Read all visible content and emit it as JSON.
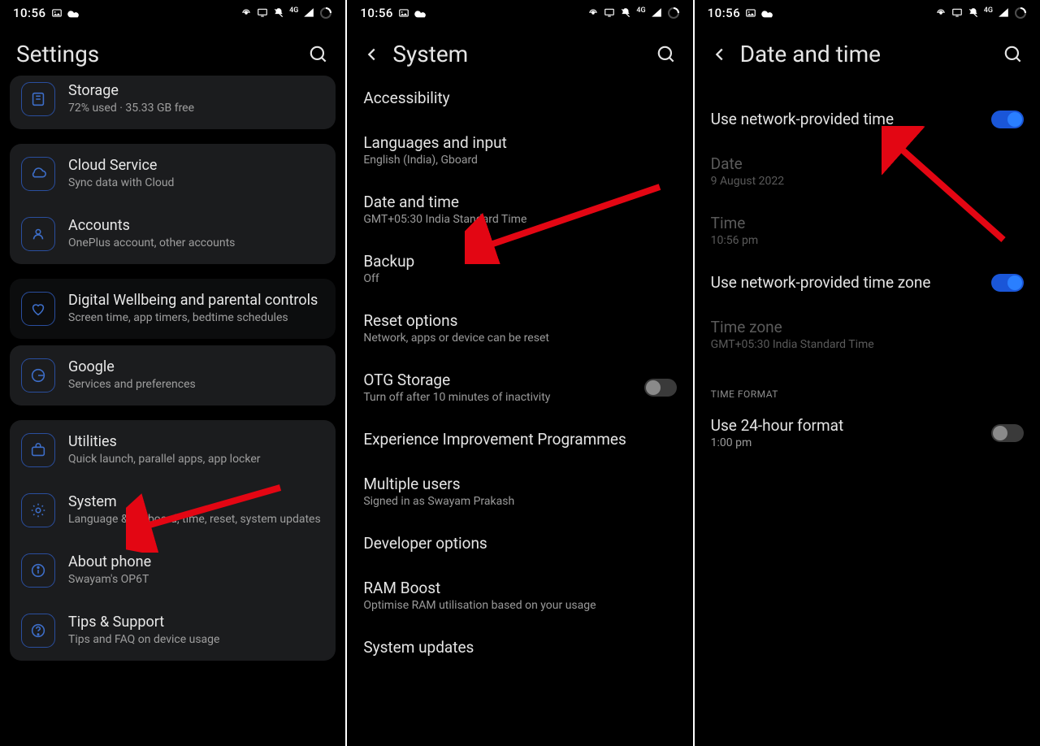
{
  "status": {
    "time": "10:56",
    "net_tag": "4G"
  },
  "p1": {
    "title": "Settings",
    "storage": {
      "title": "Storage",
      "sub": "72% used · 35.33 GB free"
    },
    "cloud": {
      "title": "Cloud Service",
      "sub": "Sync data with Cloud"
    },
    "accounts": {
      "title": "Accounts",
      "sub": "OnePlus account, other accounts"
    },
    "wellbeing": {
      "title": "Digital Wellbeing and parental controls",
      "sub": "Screen time, app timers, bedtime schedules"
    },
    "google": {
      "title": "Google",
      "sub": "Services and preferences"
    },
    "utilities": {
      "title": "Utilities",
      "sub": "Quick launch, parallel apps, app locker"
    },
    "system": {
      "title": "System",
      "sub": "Language & keyboard, time, reset, system updates"
    },
    "about": {
      "title": "About phone",
      "sub": "Swayam's OP6T"
    },
    "tips": {
      "title": "Tips & Support",
      "sub": "Tips and FAQ on device usage"
    }
  },
  "p2": {
    "title": "System",
    "access": {
      "t": "Accessibility"
    },
    "lang": {
      "t": "Languages and input",
      "s": "English (India), Gboard"
    },
    "datetime": {
      "t": "Date and time",
      "s": "GMT+05:30 India Standard Time"
    },
    "backup": {
      "t": "Backup",
      "s": "Off"
    },
    "reset": {
      "t": "Reset options",
      "s": "Network, apps or device can be reset"
    },
    "otg": {
      "t": "OTG Storage",
      "s": "Turn off after 10 minutes of inactivity"
    },
    "exp": {
      "t": "Experience Improvement Programmes"
    },
    "multi": {
      "t": "Multiple users",
      "s": "Signed in as Swayam Prakash"
    },
    "dev": {
      "t": "Developer options"
    },
    "ram": {
      "t": "RAM Boost",
      "s": "Optimise RAM utilisation based on your usage"
    },
    "sysupd": {
      "t": "System updates"
    }
  },
  "p3": {
    "title": "Date and time",
    "net_time": {
      "t": "Use network-provided time"
    },
    "date": {
      "t": "Date",
      "s": "9 August 2022"
    },
    "time": {
      "t": "Time",
      "s": "10:56 pm"
    },
    "net_zone": {
      "t": "Use network-provided time zone"
    },
    "zone": {
      "t": "Time zone",
      "s": "GMT+05:30 India Standard Time"
    },
    "format_section": "TIME FORMAT",
    "hr24": {
      "t": "Use 24-hour format",
      "s": "1:00 pm"
    }
  }
}
